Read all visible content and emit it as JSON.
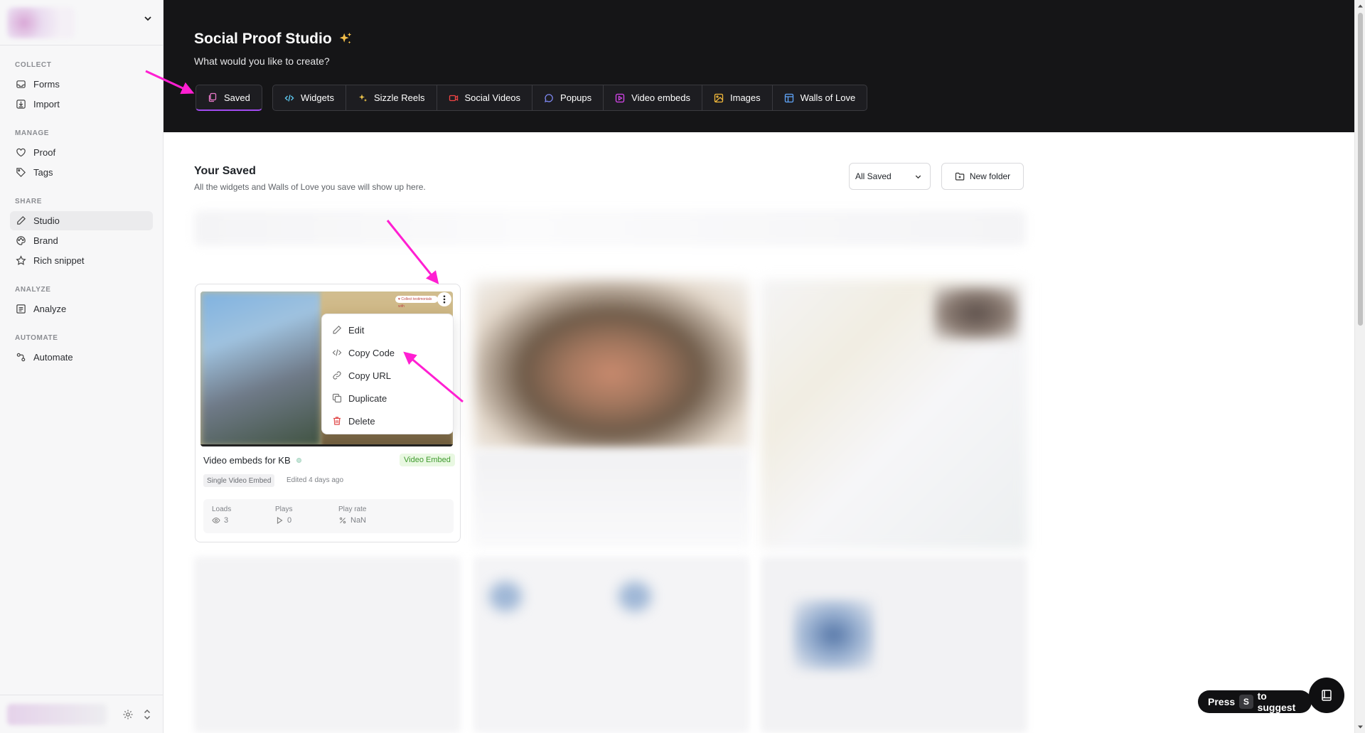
{
  "sidebar": {
    "sections": [
      {
        "title": "COLLECT",
        "items": [
          {
            "label": "Forms",
            "icon": "inbox-icon"
          },
          {
            "label": "Import",
            "icon": "import-icon"
          }
        ]
      },
      {
        "title": "MANAGE",
        "items": [
          {
            "label": "Proof",
            "icon": "heart-icon"
          },
          {
            "label": "Tags",
            "icon": "tag-icon"
          }
        ]
      },
      {
        "title": "SHARE",
        "items": [
          {
            "label": "Studio",
            "icon": "pen-icon",
            "active": true
          },
          {
            "label": "Brand",
            "icon": "palette-icon"
          },
          {
            "label": "Rich snippet",
            "icon": "star-icon"
          }
        ]
      },
      {
        "title": "ANALYZE",
        "items": [
          {
            "label": "Analyze",
            "icon": "analyze-icon"
          }
        ]
      },
      {
        "title": "AUTOMATE",
        "items": [
          {
            "label": "Automate",
            "icon": "automate-icon"
          }
        ]
      }
    ]
  },
  "header": {
    "title": "Social Proof Studio",
    "subtitle": "What would you like to create?",
    "saved_tab": "Saved",
    "tabs": [
      "Widgets",
      "Sizzle Reels",
      "Social Videos",
      "Popups",
      "Video embeds",
      "Images",
      "Walls of Love"
    ]
  },
  "main": {
    "title": "Your Saved",
    "subtitle": "All the widgets and Walls of Love you save will show up here.",
    "filter_value": "All Saved",
    "new_folder_label": "New folder"
  },
  "card": {
    "title": "Video embeds for KB",
    "badge": "Video Embed",
    "chip": "Single Video Embed",
    "edited": "Edited 4 days ago",
    "thumb_pill": "♥ Collect testimonials with",
    "stats": {
      "loads_label": "Loads",
      "loads_value": "3",
      "plays_label": "Plays",
      "plays_value": "0",
      "rate_label": "Play rate",
      "rate_value": "NaN"
    }
  },
  "menu": {
    "items": [
      {
        "label": "Edit",
        "icon": "edit-icon"
      },
      {
        "label": "Copy Code",
        "icon": "code-icon"
      },
      {
        "label": "Copy URL",
        "icon": "link-icon"
      },
      {
        "label": "Duplicate",
        "icon": "duplicate-icon"
      },
      {
        "label": "Delete",
        "icon": "trash-icon"
      }
    ]
  },
  "suggest": {
    "press": "Press",
    "key": "S",
    "suffix": "to suggest"
  },
  "colors": {
    "accent": "#a14bf0",
    "annotation": "#ff1fd2",
    "header_bg": "#151517"
  }
}
